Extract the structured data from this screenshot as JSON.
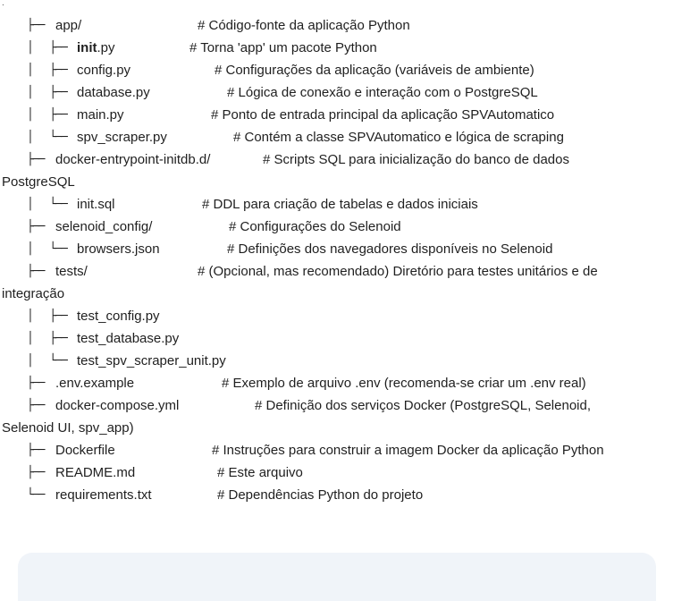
{
  "tree": [
    {
      "prefix": "├── ",
      "name_pre": "",
      "name_bold": "",
      "name": "app/",
      "comment": "# Código-fonte da aplicação Python",
      "wrap": ""
    },
    {
      "prefix": "│   ├── ",
      "name_pre": "",
      "name_bold": "init",
      "name": ".py",
      "comment": "# Torna 'app' um pacote Python",
      "wrap": ""
    },
    {
      "prefix": "│   ├── ",
      "name_pre": "",
      "name_bold": "",
      "name": "config.py",
      "comment": "# Configurações da aplicação (variáveis de ambiente)",
      "wrap": ""
    },
    {
      "prefix": "│   ├── ",
      "name_pre": "",
      "name_bold": "",
      "name": "database.py",
      "comment": "# Lógica de conexão e interação com o PostgreSQL",
      "wrap": ""
    },
    {
      "prefix": "│   ├── ",
      "name_pre": "",
      "name_bold": "",
      "name": "main.py",
      "comment": "# Ponto de entrada principal da aplicação SPVAutomatico",
      "wrap": ""
    },
    {
      "prefix": "│   └── ",
      "name_pre": "",
      "name_bold": "",
      "name": "spv_scraper.py",
      "comment": "# Contém a classe SPVAutomatico e lógica de scraping",
      "wrap": ""
    },
    {
      "prefix": "├── ",
      "name_pre": "",
      "name_bold": "",
      "name": "docker-entrypoint-initdb.d/",
      "comment": "# Scripts SQL para inicialização do banco de dados",
      "wrap": "PostgreSQL"
    },
    {
      "prefix": "│   └── ",
      "name_pre": "",
      "name_bold": "",
      "name": "init.sql",
      "comment": "# DDL para criação de tabelas e dados iniciais",
      "wrap": ""
    },
    {
      "prefix": "├── ",
      "name_pre": "",
      "name_bold": "",
      "name": "selenoid_config/",
      "comment": "# Configurações do Selenoid",
      "wrap": ""
    },
    {
      "prefix": "│   └── ",
      "name_pre": "",
      "name_bold": "",
      "name": "browsers.json",
      "comment": "# Definições dos navegadores disponíveis no Selenoid",
      "wrap": ""
    },
    {
      "prefix": "├── ",
      "name_pre": "",
      "name_bold": "",
      "name": "tests/",
      "comment": "# (Opcional, mas recomendado) Diretório para testes unitários e de",
      "wrap": "integração"
    },
    {
      "prefix": "│   ├── ",
      "name_pre": "",
      "name_bold": "",
      "name": "test_config.py",
      "comment": "",
      "wrap": ""
    },
    {
      "prefix": "│   ├── ",
      "name_pre": "",
      "name_bold": "",
      "name": "test_database.py",
      "comment": "",
      "wrap": ""
    },
    {
      "prefix": "│   └── ",
      "name_pre": "",
      "name_bold": "",
      "name": "test_spv_scraper_unit.py",
      "comment": "",
      "wrap": ""
    },
    {
      "prefix": "├── ",
      "name_pre": "",
      "name_bold": "",
      "name": ".env.example",
      "comment": "# Exemplo de arquivo .env (recomenda-se criar um .env real)",
      "wrap": ""
    },
    {
      "prefix": "├── ",
      "name_pre": "",
      "name_bold": "",
      "name": "docker-compose.yml",
      "comment": "# Definição dos serviços Docker (PostgreSQL, Selenoid,",
      "wrap": "Selenoid UI, spv_app)"
    },
    {
      "prefix": "├── ",
      "name_pre": "",
      "name_bold": "",
      "name": "Dockerfile",
      "comment": "# Instruções para construir a imagem Docker da aplicação Python",
      "wrap": ""
    },
    {
      "prefix": "├── ",
      "name_pre": "",
      "name_bold": "",
      "name": "README.md",
      "comment": "# Este arquivo",
      "wrap": ""
    },
    {
      "prefix": "└── ",
      "name_pre": "",
      "name_bold": "",
      "name": "requirements.txt",
      "comment": "# Dependências Python do projeto",
      "wrap": ""
    }
  ]
}
